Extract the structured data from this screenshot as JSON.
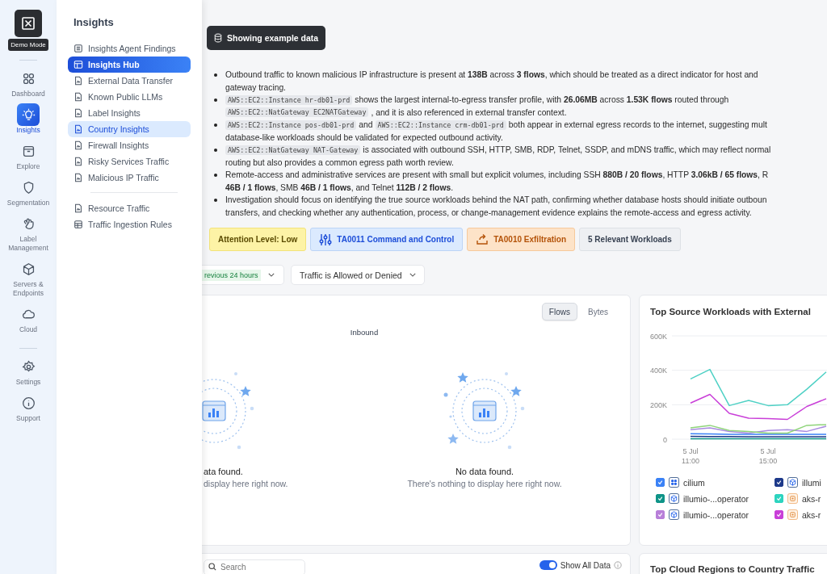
{
  "rail": {
    "tooltip": "Demo Mode",
    "groups": [
      [
        {
          "label": "Dashboard",
          "selected": false
        },
        {
          "label": "Insights",
          "selected": true
        },
        {
          "label": "Explore",
          "selected": false
        },
        {
          "label": "Segmentation",
          "selected": false
        },
        {
          "label": "Label Management",
          "selected": false
        },
        {
          "label": "Servers & Endpoints",
          "selected": false
        },
        {
          "label": "Cloud",
          "selected": false
        }
      ],
      [
        {
          "label": "Settings",
          "selected": false
        },
        {
          "label": "Support",
          "selected": false
        }
      ]
    ]
  },
  "flyout": {
    "title": "Insights",
    "groups": [
      [
        {
          "label": "Insights Agent Findings",
          "selected": false,
          "highlighted": false
        },
        {
          "label": "Insights Hub",
          "selected": true,
          "highlighted": false
        },
        {
          "label": "External Data Transfer",
          "selected": false,
          "highlighted": false
        },
        {
          "label": "Known Public LLMs",
          "selected": false,
          "highlighted": false
        },
        {
          "label": "Label Insights",
          "selected": false,
          "highlighted": false
        },
        {
          "label": "Country Insights",
          "selected": false,
          "highlighted": true
        },
        {
          "label": "Firewall Insights",
          "selected": false,
          "highlighted": false
        },
        {
          "label": "Risky Services Traffic",
          "selected": false,
          "highlighted": false
        },
        {
          "label": "Malicious IP Traffic",
          "selected": false,
          "highlighted": false
        }
      ],
      [
        {
          "label": "Resource Traffic",
          "selected": false,
          "highlighted": false
        },
        {
          "label": "Traffic Ingestion Rules",
          "selected": false,
          "highlighted": false
        }
      ]
    ]
  },
  "example_badge": "Showing example data",
  "bullets": [
    [
      [
        {
          "kind": "text",
          "text": "Outbound traffic to known malicious IP infrastructure is present at **138B** across **3 flows**, which should be treated as a direct indicator for host and"
        }
      ],
      [
        {
          "kind": "text",
          "text": "gateway tracing."
        }
      ]
    ],
    [
      [
        {
          "kind": "code",
          "text": "AWS::EC2::Instance hr-db01-prd"
        },
        {
          "kind": "text",
          "text": "shows the largest internal-to-egress transfer profile, with **26.06MB** across **1.53K flows** routed through"
        }
      ],
      [
        {
          "kind": "code",
          "text": "AWS::EC2::NatGateway EC2NATGateway"
        },
        {
          "kind": "text",
          "text": ", and it is also referenced in external transfer context."
        }
      ]
    ],
    [
      [
        {
          "kind": "code",
          "text": "AWS::EC2::Instance pos-db01-prd"
        },
        {
          "kind": "text",
          "text": "and"
        },
        {
          "kind": "code",
          "text": "AWS::EC2::Instance crm-db01-prd"
        },
        {
          "kind": "text",
          "text": "both appear in external egress records to the internet, suggesting mult"
        }
      ],
      [
        {
          "kind": "text",
          "text": "database-like workloads should be validated for expected outbound activity."
        }
      ]
    ],
    [
      [
        {
          "kind": "code",
          "text": "AWS::EC2::NatGateway NAT-Gateway"
        },
        {
          "kind": "text",
          "text": "is associated with outbound SSH, HTTP, SMB, RDP, Telnet, SSDP, and mDNS traffic, which may reflect normal"
        }
      ],
      [
        {
          "kind": "text",
          "text": "routing but also provides a common egress path worth review."
        }
      ]
    ],
    [
      [
        {
          "kind": "text",
          "text": "Remote-access and administrative services are present with small but explicit volumes, including SSH **880B / 20 flows**, HTTP **3.06kB / 65 flows**, R"
        }
      ],
      [
        {
          "kind": "text",
          "text": "**46B / 1 flows**, SMB **46B / 1 flows**, and Telnet **112B / 2 flows**."
        }
      ]
    ],
    [
      [
        {
          "kind": "text",
          "text": "Investigation should focus on identifying the true source workloads behind the NAT path, confirming whether database hosts should initiate outboun"
        }
      ],
      [
        {
          "kind": "text",
          "text": "transfers, and checking whether any authentication, process, or change-management evidence explains the remote-access and egress activity."
        }
      ]
    ]
  ],
  "tags": [
    {
      "kind": "attention",
      "label": "Attention Level: Low"
    },
    {
      "kind": "command",
      "label": "TA0011 Command and Control"
    },
    {
      "kind": "exfiltration",
      "label": "TA0010 Exfiltration"
    },
    {
      "kind": "count",
      "label": "5 Relevant Workloads"
    }
  ],
  "filters": [
    {
      "kind": "time",
      "label": "revious 24 hours"
    },
    {
      "kind": "plain",
      "label": "Traffic is Allowed or Denied"
    }
  ],
  "traffic_card": {
    "options": [
      {
        "label": "Flows",
        "selected": true
      },
      {
        "label": "Bytes",
        "selected": false
      }
    ],
    "direction": "Inbound",
    "empty_states": [
      {
        "title": "ata found.",
        "message": "display here right now."
      },
      {
        "title": "No data found.",
        "message": "There's nothing to display here right now."
      }
    ]
  },
  "workloads_card": {
    "title": "Top Source Workloads with External",
    "chart_data": {
      "type": "line",
      "categories": [
        "5 Jul 11:00",
        null,
        null,
        null,
        "5 Jul 15:00",
        null,
        null,
        null
      ],
      "ylim": [
        0,
        600000
      ],
      "yticks": [
        {
          "value": 0,
          "label": "0"
        },
        {
          "value": 200000,
          "label": "200K"
        },
        {
          "value": 400000,
          "label": "400K"
        },
        {
          "value": 600000,
          "label": "600K"
        }
      ],
      "series": [
        {
          "color": "#3b82f6",
          "values": [
            32000,
            30000,
            28000,
            28000,
            28000,
            28000,
            28000,
            28000
          ]
        },
        {
          "color": "#1e3a8a",
          "values": [
            16000,
            15000,
            15000,
            14000,
            14000,
            14000,
            14000,
            14000
          ]
        },
        {
          "color": "#0f9488",
          "values": [
            2000,
            2000,
            2000,
            2000,
            2000,
            2000,
            2000,
            2000
          ]
        },
        {
          "color": "#4fd1c5",
          "values": [
            350000,
            405000,
            195000,
            225000,
            195000,
            200000,
            290000,
            390000
          ]
        },
        {
          "color": "#a98be0",
          "values": [
            55000,
            65000,
            45000,
            35000,
            50000,
            55000,
            45000,
            75000
          ]
        },
        {
          "color": "#c93fd8",
          "values": [
            210000,
            260000,
            150000,
            122000,
            120000,
            115000,
            190000,
            235000
          ]
        },
        {
          "color": "#8fd47a",
          "values": [
            65000,
            80000,
            50000,
            45000,
            35000,
            35000,
            80000,
            85000
          ]
        }
      ]
    },
    "legend": [
      {
        "label": "cilium",
        "color": "#3b82f6",
        "checked": true,
        "kind": "cluster"
      },
      {
        "label": "illumi",
        "color": "#1e3a8a",
        "checked": true,
        "kind": "pod"
      },
      {
        "label": "illumio-...operator",
        "color": "#0f9488",
        "checked": true,
        "kind": "pod"
      },
      {
        "label": "aks-r",
        "color": "#2dd4bf",
        "checked": true,
        "kind": "node"
      },
      {
        "label": "illumio-...operator",
        "color": "#b87fd9",
        "checked": true,
        "kind": "pod"
      },
      {
        "label": "aks-r",
        "color": "#c93fd8",
        "checked": true,
        "kind": "node"
      }
    ]
  },
  "table_card": {
    "search": {
      "placeholder": "Search"
    },
    "show_all": {
      "label": "Show All Data",
      "on": true
    }
  },
  "regions_card": {
    "title": "Top Cloud Regions to Country Traffic"
  }
}
